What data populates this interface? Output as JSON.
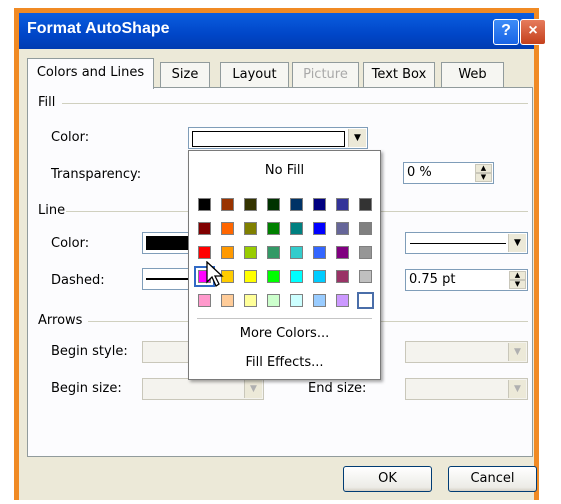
{
  "window": {
    "title": "Format AutoShape",
    "help_label": "?",
    "close_label": "×"
  },
  "tabs": [
    "Colors and Lines",
    "Size",
    "Layout",
    "Picture",
    "Text Box",
    "Web"
  ],
  "fill": {
    "section_label": "Fill",
    "color_label": "Color:",
    "transparency_label": "Transparency:",
    "transparency_value": "0 %"
  },
  "line": {
    "section_label": "Line",
    "color_label": "Color:",
    "dashed_label": "Dashed:",
    "weight_value": "0.75 pt"
  },
  "arrows": {
    "section_label": "Arrows",
    "begin_style_label": "Begin style:",
    "begin_size_label": "Begin size:",
    "end_size_label": "End size:"
  },
  "color_popup": {
    "no_fill_label": "No Fill",
    "more_colors_label": "More Colors...",
    "fill_effects_label": "Fill Effects...",
    "palette": [
      [
        "#000000",
        "#993300",
        "#333300",
        "#003300",
        "#003366",
        "#000080",
        "#333399",
        "#333333"
      ],
      [
        "#800000",
        "#FF6600",
        "#808000",
        "#008000",
        "#008080",
        "#0000FF",
        "#666699",
        "#808080"
      ],
      [
        "#FF0000",
        "#FF9900",
        "#99CC00",
        "#339966",
        "#33CCCC",
        "#3366FF",
        "#800080",
        "#969696"
      ],
      [
        "#FF00FF",
        "#FFCC00",
        "#FFFF00",
        "#00FF00",
        "#00FFFF",
        "#00CCFF",
        "#993366",
        "#C0C0C0"
      ],
      [
        "#FF99CC",
        "#FFCC99",
        "#FFFF99",
        "#CCFFCC",
        "#CCFFFF",
        "#99CCFF",
        "#CC99FF",
        "#FFFFFF"
      ]
    ]
  },
  "buttons": {
    "ok_label": "OK",
    "cancel_label": "Cancel"
  }
}
